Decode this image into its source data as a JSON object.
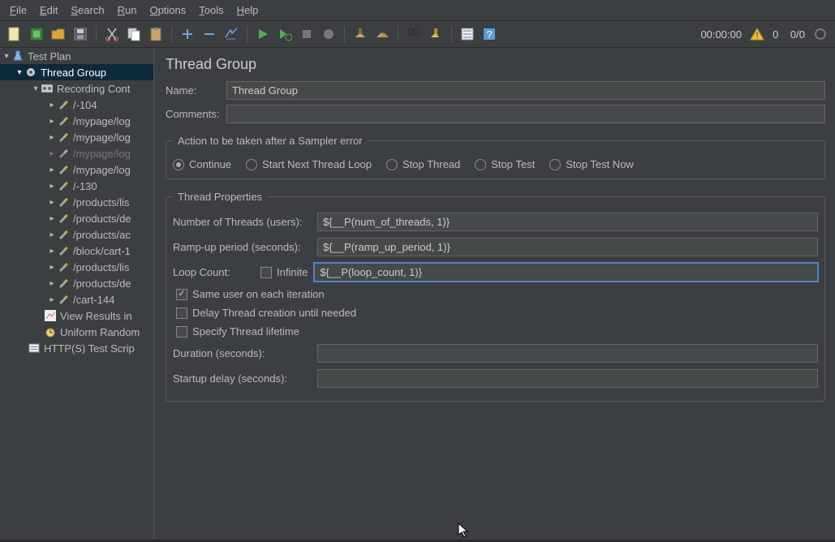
{
  "menu": {
    "file": "File",
    "edit": "Edit",
    "search": "Search",
    "run": "Run",
    "options": "Options",
    "tools": "Tools",
    "help": "Help"
  },
  "toolbar_status": {
    "time": "00:00:00",
    "warn": "0",
    "ratio": "0/0"
  },
  "tree": {
    "root": "Test Plan",
    "thread_group": "Thread Group",
    "recording": "Recording Cont",
    "samples": [
      "/-104",
      "/mypage/log",
      "/mypage/log",
      "/mypage/log",
      "/mypage/log",
      "/-130",
      "/products/lis",
      "/products/de",
      "/products/ac",
      "/block/cart-1",
      "/products/lis",
      "/products/de",
      "/cart-144"
    ],
    "results": "View Results in",
    "uniform": "Uniform Random",
    "http_script": "HTTP(S) Test Scrip"
  },
  "dimmed_index": 3,
  "page_title": "Thread Group",
  "name_label": "Name:",
  "name_value": "Thread Group",
  "comments_label": "Comments:",
  "comments_value": "",
  "error_legend": "Action to be taken after a Sampler error",
  "error_options": {
    "continue": "Continue",
    "startnext": "Start Next Thread Loop",
    "stopthread": "Stop Thread",
    "stoptest": "Stop Test",
    "stopnow": "Stop Test Now"
  },
  "tp_legend": "Thread Properties",
  "tp": {
    "numthreads_label": "Number of Threads (users):",
    "numthreads_value": "${__P(num_of_threads, 1)}",
    "ramp_label": "Ramp-up period (seconds):",
    "ramp_value": "${__P(ramp_up_period, 1)}",
    "loop_label": "Loop Count:",
    "infinite_label": "Infinite",
    "loop_value": "${__P(loop_count, 1)}",
    "sameuser": "Same user on each iteration",
    "delay": "Delay Thread creation until needed",
    "specify": "Specify Thread lifetime",
    "duration_label": "Duration (seconds):",
    "duration_value": "",
    "startup_label": "Startup delay (seconds):",
    "startup_value": ""
  }
}
